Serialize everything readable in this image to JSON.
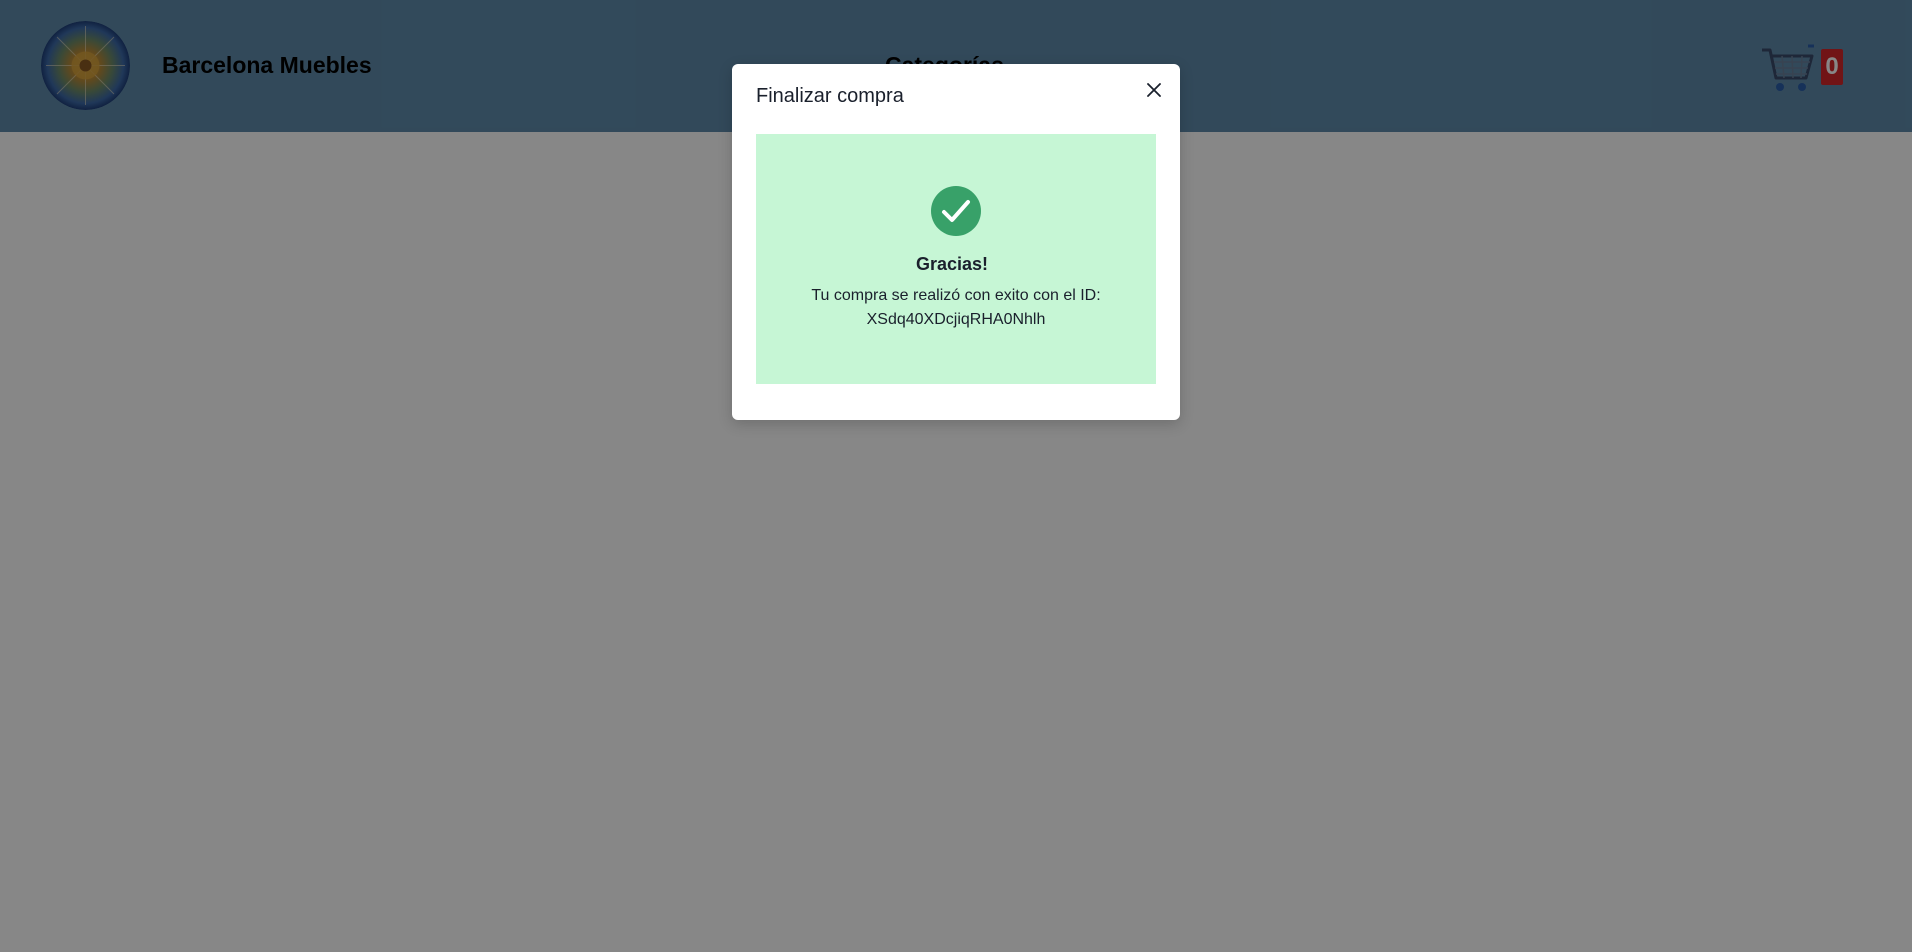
{
  "header": {
    "brand_name": "Barcelona Muebles",
    "categories_label": "Categorías",
    "cart_count": "0",
    "logo_icon": "mosaic-logo-icon",
    "cart_icon": "shopping-cart-icon"
  },
  "modal": {
    "title": "Finalizar compra",
    "close_icon": "close-icon",
    "success": {
      "icon": "check-circle-icon",
      "heading": "Gracias!",
      "message_line1": "Tu compra se realizó con exito con el ID:",
      "order_id": "XSdq40XDcjiqRHA0Nhlh"
    }
  },
  "colors": {
    "header_bg": "#5f8bab",
    "success_bg": "#c6f6d5",
    "success_icon": "#38a169",
    "badge_bg": "#d6262a"
  }
}
